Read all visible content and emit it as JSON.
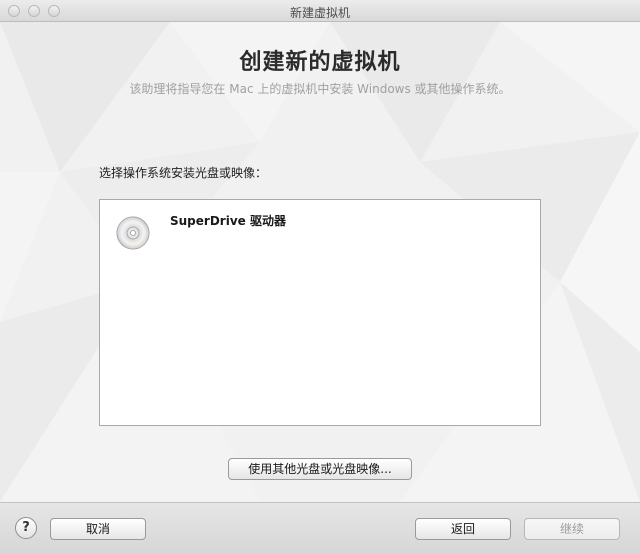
{
  "window": {
    "title": "新建虚拟机"
  },
  "header": {
    "title": "创建新的虚拟机",
    "subtitle": "该助理将指导您在 Mac 上的虚拟机中安装 Windows 或其他操作系统。"
  },
  "main": {
    "prompt": "选择操作系统安装光盘或映像：",
    "sources": [
      {
        "label": "SuperDrive 驱动器",
        "icon": "optical-disc-icon"
      }
    ],
    "other_button_label": "使用其他光盘或光盘映像..."
  },
  "footer": {
    "help_label": "?",
    "cancel_label": "取消",
    "back_label": "返回",
    "continue_label": "继续",
    "continue_enabled": false
  },
  "colors": {
    "background": "#efefef",
    "title_text": "#2b2b2b",
    "subtitle_text": "#a0a0a0",
    "disabled_text": "#9c9c9c"
  }
}
